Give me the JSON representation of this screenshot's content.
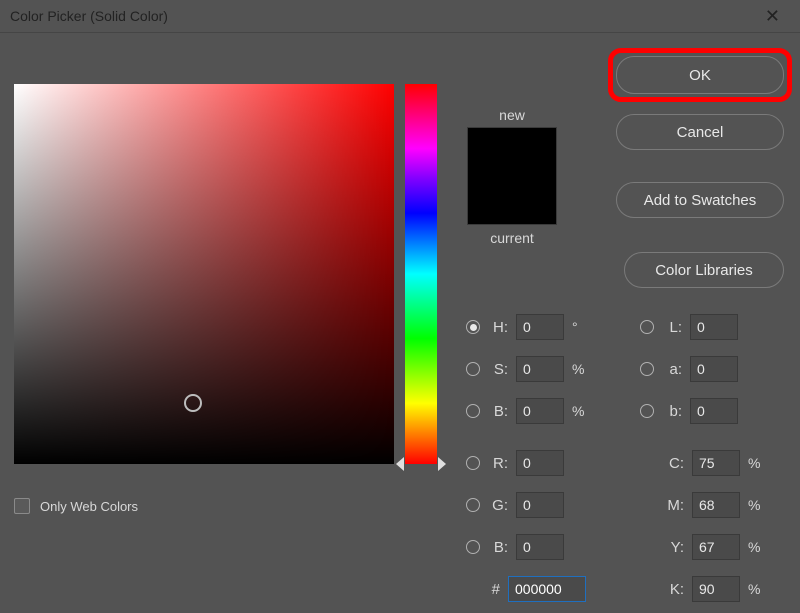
{
  "title": "Color Picker (Solid Color)",
  "buttons": {
    "ok": "OK",
    "cancel": "Cancel",
    "add_swatches": "Add to Swatches",
    "color_libraries": "Color Libraries"
  },
  "preview": {
    "new_label": "new",
    "current_label": "current",
    "new_color": "#000000",
    "current_color": "#000000"
  },
  "only_web_label": "Only Web Colors",
  "only_web_checked": false,
  "sat_marker": {
    "x_pct": 47,
    "y_pct": 84
  },
  "hue_arrow_pct": 100,
  "hsv": {
    "h_label": "H:",
    "h_value": "0",
    "h_unit": "°",
    "h_selected": true,
    "s_label": "S:",
    "s_value": "0",
    "s_unit": "%",
    "s_selected": false,
    "b_label": "B:",
    "b_value": "0",
    "b_unit": "%",
    "b_selected": false
  },
  "rgb": {
    "r_label": "R:",
    "r_value": "0",
    "g_label": "G:",
    "g_value": "0",
    "b_label": "B:",
    "b_value": "0"
  },
  "lab": {
    "l_label": "L:",
    "l_value": "0",
    "l_selected": false,
    "a_label": "a:",
    "a_value": "0",
    "a_selected": false,
    "b_label": "b:",
    "b_value": "0",
    "b_selected": false
  },
  "cmyk": {
    "c_label": "C:",
    "c_value": "75",
    "unit": "%",
    "m_label": "M:",
    "m_value": "68",
    "y_label": "Y:",
    "y_value": "67",
    "k_label": "K:",
    "k_value": "90"
  },
  "hex": {
    "label": "#",
    "value": "000000"
  }
}
